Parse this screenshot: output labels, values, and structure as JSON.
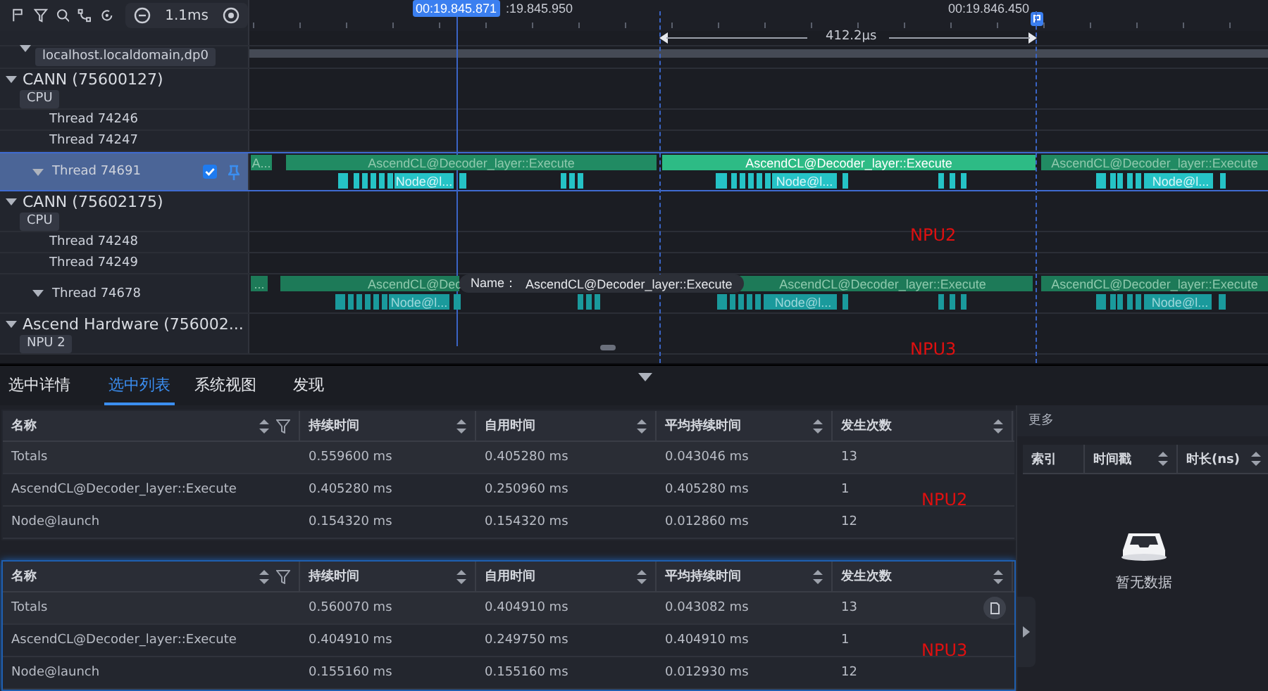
{
  "toolbar": {
    "zoom": "1.1ms"
  },
  "ruler": {
    "cursor": "00:19.845.871",
    "ticks": [
      ":19.845.950",
      "00:19.846.450"
    ],
    "measure": "412.2µs"
  },
  "tracks": [
    {
      "kind": "spacer"
    },
    {
      "kind": "host",
      "tag": "localhost.localdomain,dp0",
      "expanded": true
    },
    {
      "kind": "process",
      "title": "CANN (75600127)",
      "tag": "CPU",
      "expanded": true
    },
    {
      "kind": "thread",
      "title": "Thread 74246"
    },
    {
      "kind": "thread",
      "title": "Thread 74247"
    },
    {
      "kind": "busy",
      "title": "Thread 74691",
      "expanded": true,
      "selected": true,
      "checked": true,
      "slices": [
        {
          "label": "A...",
          "selected": false
        },
        {
          "label": "AscendCL@Decoder_layer::Execute",
          "selected": false
        },
        {
          "label": "AscendCL@Decoder_layer::Execute",
          "selected": true
        },
        {
          "label": "AscendCL@Decoder_layer::Execute",
          "selected": false
        }
      ],
      "sub_slices": [
        "Node@l...",
        "Node@l...",
        "Node@l..."
      ]
    },
    {
      "kind": "process",
      "title": "CANN (75602175)",
      "tag": "CPU",
      "expanded": true
    },
    {
      "kind": "thread",
      "title": "Thread 74248"
    },
    {
      "kind": "thread",
      "title": "Thread 74249"
    },
    {
      "kind": "busy",
      "title": "Thread 74678",
      "expanded": true,
      "selected": false,
      "slices": [
        {
          "label": "...",
          "selected": false
        },
        {
          "label": "AscendCL@Dec",
          "selected": false
        },
        {
          "label": "AscendCL@Decoder_layer::Execute",
          "selected": false
        },
        {
          "label": "AscendCL@Decoder_layer::Execute",
          "selected": false
        }
      ],
      "sub_slices": [
        "Node@l...",
        "Node@l...",
        "Node@l..."
      ]
    },
    {
      "kind": "process",
      "title": "Ascend Hardware (756002...",
      "tag": "NPU 2",
      "expanded": true
    }
  ],
  "tooltip": {
    "label": "Name：",
    "value": "AscendCL@Decoder_layer::Execute"
  },
  "notes": [
    "NPU2",
    "NPU3"
  ],
  "tabs": [
    {
      "label": "选中详情",
      "selected": false
    },
    {
      "label": "选中列表",
      "selected": true
    },
    {
      "label": "系统视图",
      "selected": false
    },
    {
      "label": "发现",
      "selected": false
    }
  ],
  "tables": [
    {
      "focused": false,
      "note": "NPU2",
      "columns": [
        "名称",
        "持续时间",
        "自用时间",
        "平均持续时间",
        "发生次数"
      ],
      "rows": [
        [
          "Totals",
          "0.559600 ms",
          "0.405280 ms",
          "0.043046 ms",
          "13"
        ],
        [
          "AscendCL@Decoder_layer::Execute",
          "0.405280 ms",
          "0.250960 ms",
          "0.405280 ms",
          "1"
        ],
        [
          "Node@launch",
          "0.154320 ms",
          "0.154320 ms",
          "0.012860 ms",
          "12"
        ]
      ]
    },
    {
      "focused": true,
      "note": "NPU3",
      "columns": [
        "名称",
        "持续时间",
        "自用时间",
        "平均持续时间",
        "发生次数"
      ],
      "rows": [
        [
          "Totals",
          "0.560070 ms",
          "0.404910 ms",
          "0.043082 ms",
          "13"
        ],
        [
          "AscendCL@Decoder_layer::Execute",
          "0.404910 ms",
          "0.249750 ms",
          "0.404910 ms",
          "1"
        ],
        [
          "Node@launch",
          "0.155160 ms",
          "0.155160 ms",
          "0.012930 ms",
          "12"
        ]
      ]
    }
  ],
  "more": {
    "title": "更多",
    "columns": [
      "索引",
      "时间戳",
      "时长(ns)"
    ],
    "empty": "暂无数据"
  }
}
